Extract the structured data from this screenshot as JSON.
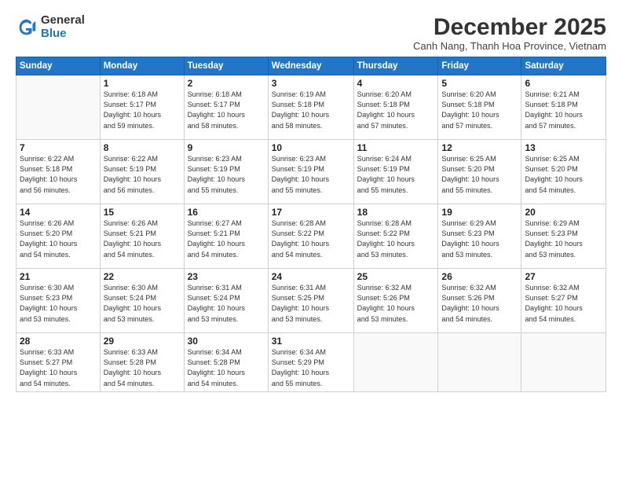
{
  "logo": {
    "general": "General",
    "blue": "Blue"
  },
  "header": {
    "month": "December 2025",
    "location": "Canh Nang, Thanh Hoa Province, Vietnam"
  },
  "weekdays": [
    "Sunday",
    "Monday",
    "Tuesday",
    "Wednesday",
    "Thursday",
    "Friday",
    "Saturday"
  ],
  "weeks": [
    [
      {
        "day": "",
        "info": ""
      },
      {
        "day": "1",
        "info": "Sunrise: 6:18 AM\nSunset: 5:17 PM\nDaylight: 10 hours\nand 59 minutes."
      },
      {
        "day": "2",
        "info": "Sunrise: 6:18 AM\nSunset: 5:17 PM\nDaylight: 10 hours\nand 58 minutes."
      },
      {
        "day": "3",
        "info": "Sunrise: 6:19 AM\nSunset: 5:18 PM\nDaylight: 10 hours\nand 58 minutes."
      },
      {
        "day": "4",
        "info": "Sunrise: 6:20 AM\nSunset: 5:18 PM\nDaylight: 10 hours\nand 57 minutes."
      },
      {
        "day": "5",
        "info": "Sunrise: 6:20 AM\nSunset: 5:18 PM\nDaylight: 10 hours\nand 57 minutes."
      },
      {
        "day": "6",
        "info": "Sunrise: 6:21 AM\nSunset: 5:18 PM\nDaylight: 10 hours\nand 57 minutes."
      }
    ],
    [
      {
        "day": "7",
        "info": "Sunrise: 6:22 AM\nSunset: 5:18 PM\nDaylight: 10 hours\nand 56 minutes."
      },
      {
        "day": "8",
        "info": "Sunrise: 6:22 AM\nSunset: 5:19 PM\nDaylight: 10 hours\nand 56 minutes."
      },
      {
        "day": "9",
        "info": "Sunrise: 6:23 AM\nSunset: 5:19 PM\nDaylight: 10 hours\nand 55 minutes."
      },
      {
        "day": "10",
        "info": "Sunrise: 6:23 AM\nSunset: 5:19 PM\nDaylight: 10 hours\nand 55 minutes."
      },
      {
        "day": "11",
        "info": "Sunrise: 6:24 AM\nSunset: 5:19 PM\nDaylight: 10 hours\nand 55 minutes."
      },
      {
        "day": "12",
        "info": "Sunrise: 6:25 AM\nSunset: 5:20 PM\nDaylight: 10 hours\nand 55 minutes."
      },
      {
        "day": "13",
        "info": "Sunrise: 6:25 AM\nSunset: 5:20 PM\nDaylight: 10 hours\nand 54 minutes."
      }
    ],
    [
      {
        "day": "14",
        "info": "Sunrise: 6:26 AM\nSunset: 5:20 PM\nDaylight: 10 hours\nand 54 minutes."
      },
      {
        "day": "15",
        "info": "Sunrise: 6:26 AM\nSunset: 5:21 PM\nDaylight: 10 hours\nand 54 minutes."
      },
      {
        "day": "16",
        "info": "Sunrise: 6:27 AM\nSunset: 5:21 PM\nDaylight: 10 hours\nand 54 minutes."
      },
      {
        "day": "17",
        "info": "Sunrise: 6:28 AM\nSunset: 5:22 PM\nDaylight: 10 hours\nand 54 minutes."
      },
      {
        "day": "18",
        "info": "Sunrise: 6:28 AM\nSunset: 5:22 PM\nDaylight: 10 hours\nand 53 minutes."
      },
      {
        "day": "19",
        "info": "Sunrise: 6:29 AM\nSunset: 5:23 PM\nDaylight: 10 hours\nand 53 minutes."
      },
      {
        "day": "20",
        "info": "Sunrise: 6:29 AM\nSunset: 5:23 PM\nDaylight: 10 hours\nand 53 minutes."
      }
    ],
    [
      {
        "day": "21",
        "info": "Sunrise: 6:30 AM\nSunset: 5:23 PM\nDaylight: 10 hours\nand 53 minutes."
      },
      {
        "day": "22",
        "info": "Sunrise: 6:30 AM\nSunset: 5:24 PM\nDaylight: 10 hours\nand 53 minutes."
      },
      {
        "day": "23",
        "info": "Sunrise: 6:31 AM\nSunset: 5:24 PM\nDaylight: 10 hours\nand 53 minutes."
      },
      {
        "day": "24",
        "info": "Sunrise: 6:31 AM\nSunset: 5:25 PM\nDaylight: 10 hours\nand 53 minutes."
      },
      {
        "day": "25",
        "info": "Sunrise: 6:32 AM\nSunset: 5:26 PM\nDaylight: 10 hours\nand 53 minutes."
      },
      {
        "day": "26",
        "info": "Sunrise: 6:32 AM\nSunset: 5:26 PM\nDaylight: 10 hours\nand 54 minutes."
      },
      {
        "day": "27",
        "info": "Sunrise: 6:32 AM\nSunset: 5:27 PM\nDaylight: 10 hours\nand 54 minutes."
      }
    ],
    [
      {
        "day": "28",
        "info": "Sunrise: 6:33 AM\nSunset: 5:27 PM\nDaylight: 10 hours\nand 54 minutes."
      },
      {
        "day": "29",
        "info": "Sunrise: 6:33 AM\nSunset: 5:28 PM\nDaylight: 10 hours\nand 54 minutes."
      },
      {
        "day": "30",
        "info": "Sunrise: 6:34 AM\nSunset: 5:28 PM\nDaylight: 10 hours\nand 54 minutes."
      },
      {
        "day": "31",
        "info": "Sunrise: 6:34 AM\nSunset: 5:29 PM\nDaylight: 10 hours\nand 55 minutes."
      },
      {
        "day": "",
        "info": ""
      },
      {
        "day": "",
        "info": ""
      },
      {
        "day": "",
        "info": ""
      }
    ]
  ]
}
